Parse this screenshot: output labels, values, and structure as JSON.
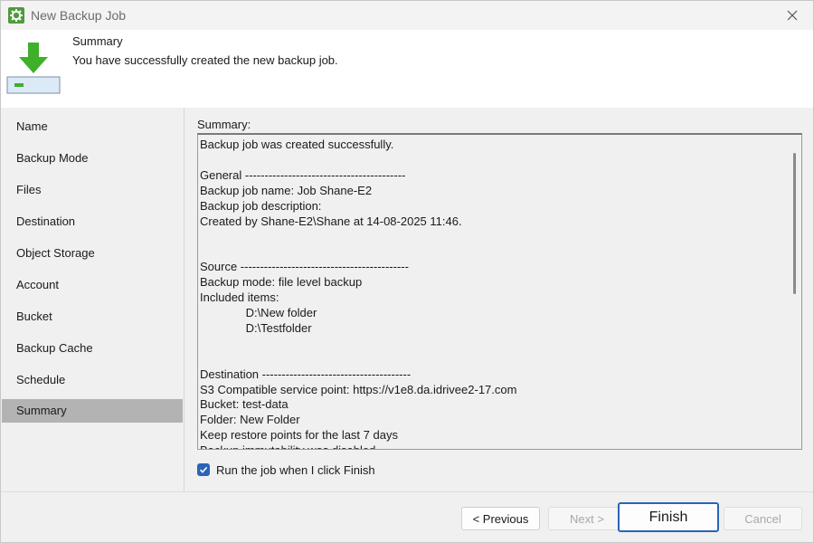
{
  "window": {
    "title": "New Backup Job"
  },
  "header": {
    "title": "Summary",
    "subtitle": "You have successfully created the new backup job."
  },
  "steps": [
    {
      "label": "Name"
    },
    {
      "label": "Backup Mode"
    },
    {
      "label": "Files"
    },
    {
      "label": "Destination"
    },
    {
      "label": "Object Storage"
    },
    {
      "label": "Account"
    },
    {
      "label": "Bucket"
    },
    {
      "label": "Backup Cache"
    },
    {
      "label": "Schedule"
    },
    {
      "label": "Summary",
      "active": true
    }
  ],
  "summary": {
    "label": "Summary:",
    "lines": [
      "Backup job was created successfully.",
      "",
      "General -----------------------------------------",
      "Backup job name: Job Shane-E2",
      "Backup job description:",
      "Created by Shane-E2\\Shane at 14-08-2025 11:46.",
      "",
      "",
      "Source -------------------------------------------",
      "Backup mode: file level backup",
      "Included items:",
      "              D:\\New folder",
      "              D:\\Testfolder",
      "",
      "",
      "Destination --------------------------------------",
      "S3 Compatible service point: https://v1e8.da.idrivee2-17.com",
      "Bucket: test-data",
      "Folder: New Folder",
      "Keep restore points for the last 7 days",
      "Backup immutability was disabled"
    ]
  },
  "options": {
    "run_job_label": "Run the job when I click Finish",
    "run_job_checked": true
  },
  "footer": {
    "previous_label": "< Previous",
    "next_label": "Next >",
    "finish_label": "Finish",
    "cancel_label": "Cancel"
  },
  "colors": {
    "accent": "#2a64b8",
    "active_step": "#b3b3b3",
    "app_icon": "#4d9b3d",
    "header_arrow": "#3fb02a"
  }
}
